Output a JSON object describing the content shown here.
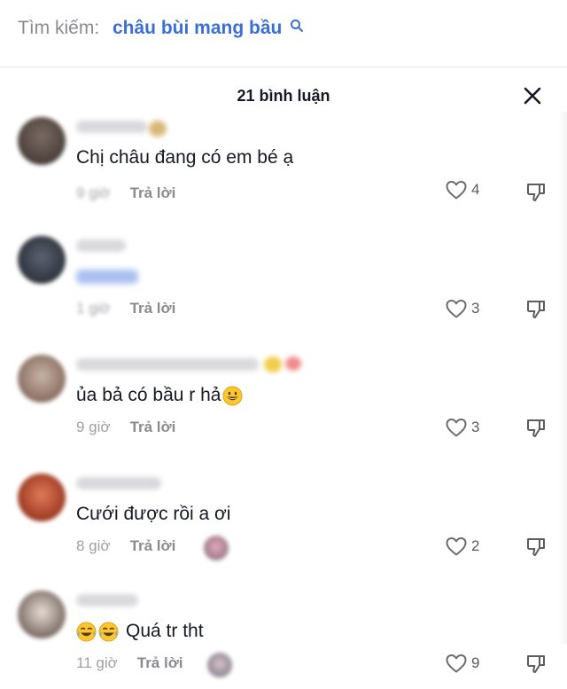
{
  "search": {
    "label": "Tìm kiếm:",
    "query": "châu bùi mang bầu"
  },
  "header": {
    "comment_count": "21 bình luận"
  },
  "icons": {
    "close": "close-icon",
    "like": "heart-outline-icon",
    "dislike": "thumbs-down-icon",
    "search": "search-icon"
  },
  "comments": [
    {
      "text": "Chị châu đang có em bé ạ",
      "time": "9 giờ",
      "reply": "Trả lời",
      "likes": "4",
      "time_blurred": true
    },
    {
      "text": "",
      "time": "1 giờ",
      "reply": "Trả lời",
      "likes": "3",
      "time_blurred": true
    },
    {
      "text": "ủa bả có bầu r hả",
      "time": "9 giờ",
      "reply": "Trả lời",
      "likes": "3",
      "time_blurred": false
    },
    {
      "text": "Cưới được rồi a ơi",
      "time": "8 giờ",
      "reply": "Trả lời",
      "likes": "2",
      "time_blurred": false
    },
    {
      "text": "Quá tr tht",
      "time": "11 giờ",
      "reply": "Trả lời",
      "likes": "9",
      "time_blurred": false
    }
  ]
}
